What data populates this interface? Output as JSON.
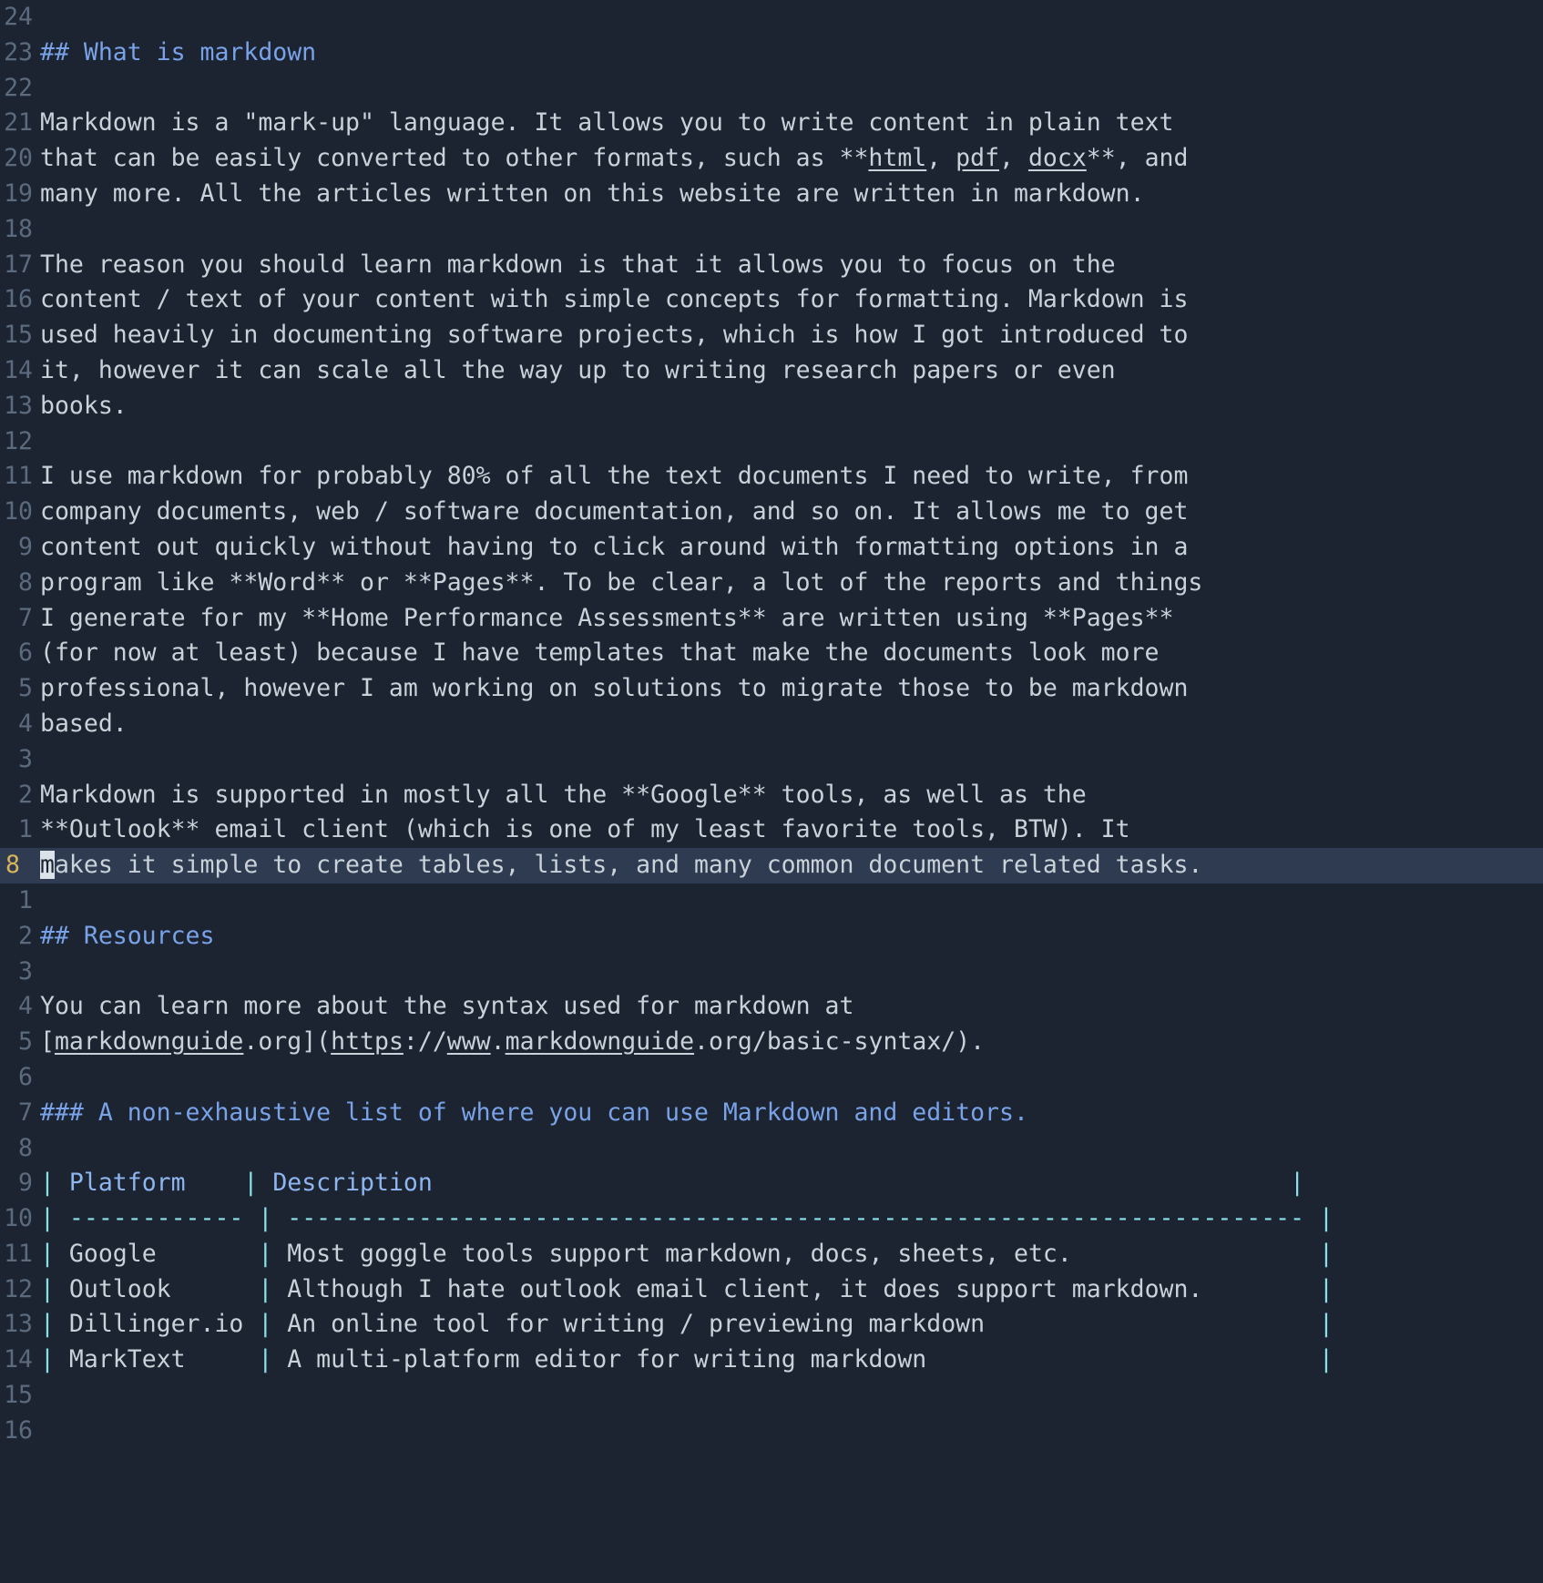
{
  "editor": {
    "name": "vim-markdown-buffer",
    "mode": "normal",
    "colors": {
      "background": "#1b2430",
      "foreground": "#c9d1d9",
      "gutter": "#5c6a7e",
      "cursorline_bg": "#2e3b50",
      "cursorline_number": "#d8b45a",
      "heading": "#7aa2e8",
      "table_pipe": "#8ae0e8",
      "table_header": "#8fb6f0",
      "cursor_block": "#dbe2ea"
    },
    "cursor": {
      "char": "m",
      "line_number": "8",
      "column": 1
    }
  },
  "lines": [
    {
      "num": "24",
      "cursorline": false,
      "kind": "blank",
      "text": ""
    },
    {
      "num": "23",
      "cursorline": false,
      "kind": "heading",
      "text": "## What is markdown"
    },
    {
      "num": "22",
      "cursorline": false,
      "kind": "blank",
      "text": ""
    },
    {
      "num": "21",
      "cursorline": false,
      "kind": "text",
      "text": "Markdown is a \"mark-up\" language. It allows you to write content in plain text"
    },
    {
      "num": "20",
      "cursorline": false,
      "kind": "underlined",
      "text": "that can be easily converted to other formats, such as **html, pdf, docx**, and",
      "segments": [
        {
          "t": "that can be easily converted to other formats, such as **",
          "u": false
        },
        {
          "t": "html",
          "u": true
        },
        {
          "t": ", ",
          "u": false
        },
        {
          "t": "pdf",
          "u": true
        },
        {
          "t": ", ",
          "u": false
        },
        {
          "t": "docx",
          "u": true
        },
        {
          "t": "**, and",
          "u": false
        }
      ]
    },
    {
      "num": "19",
      "cursorline": false,
      "kind": "text",
      "text": "many more. All the articles written on this website are written in markdown."
    },
    {
      "num": "18",
      "cursorline": false,
      "kind": "blank",
      "text": ""
    },
    {
      "num": "17",
      "cursorline": false,
      "kind": "text",
      "text": "The reason you should learn markdown is that it allows you to focus on the"
    },
    {
      "num": "16",
      "cursorline": false,
      "kind": "text",
      "text": "content / text of your content with simple concepts for formatting. Markdown is"
    },
    {
      "num": "15",
      "cursorline": false,
      "kind": "text",
      "text": "used heavily in documenting software projects, which is how I got introduced to"
    },
    {
      "num": "14",
      "cursorline": false,
      "kind": "text",
      "text": "it, however it can scale all the way up to writing research papers or even"
    },
    {
      "num": "13",
      "cursorline": false,
      "kind": "text",
      "text": "books."
    },
    {
      "num": "12",
      "cursorline": false,
      "kind": "blank",
      "text": ""
    },
    {
      "num": "11",
      "cursorline": false,
      "kind": "text",
      "text": "I use markdown for probably 80% of all the text documents I need to write, from"
    },
    {
      "num": "10",
      "cursorline": false,
      "kind": "text",
      "text": "company documents, web / software documentation, and so on. It allows me to get"
    },
    {
      "num": "9",
      "cursorline": false,
      "kind": "text",
      "text": "content out quickly without having to click around with formatting options in a"
    },
    {
      "num": "8",
      "cursorline": false,
      "kind": "text",
      "text": "program like **Word** or **Pages**. To be clear, a lot of the reports and things"
    },
    {
      "num": "7",
      "cursorline": false,
      "kind": "text",
      "text": "I generate for my **Home Performance Assessments** are written using **Pages**"
    },
    {
      "num": "6",
      "cursorline": false,
      "kind": "text",
      "text": "(for now at least) because I have templates that make the documents look more"
    },
    {
      "num": "5",
      "cursorline": false,
      "kind": "text",
      "text": "professional, however I am working on solutions to migrate those to be markdown"
    },
    {
      "num": "4",
      "cursorline": false,
      "kind": "text",
      "text": "based."
    },
    {
      "num": "3",
      "cursorline": false,
      "kind": "blank",
      "text": ""
    },
    {
      "num": "2",
      "cursorline": false,
      "kind": "text",
      "text": "Markdown is supported in mostly all the **Google** tools, as well as the"
    },
    {
      "num": "1",
      "cursorline": false,
      "kind": "text",
      "text": "**Outlook** email client (which is one of my least favorite tools, BTW). It"
    },
    {
      "num": "8",
      "cursorline": true,
      "kind": "cursor",
      "text": "makes it simple to create tables, lists, and many common document related tasks.",
      "cursor_char": "m",
      "rest": "akes it simple to create tables, lists, and many common document related tasks."
    },
    {
      "num": "1",
      "cursorline": false,
      "kind": "blank",
      "text": ""
    },
    {
      "num": "2",
      "cursorline": false,
      "kind": "heading",
      "text": "## Resources"
    },
    {
      "num": "3",
      "cursorline": false,
      "kind": "blank",
      "text": ""
    },
    {
      "num": "4",
      "cursorline": false,
      "kind": "text",
      "text": "You can learn more about the syntax used for markdown at"
    },
    {
      "num": "5",
      "cursorline": false,
      "kind": "underlined",
      "text": "[markdownguide.org](https://www.markdownguide.org/basic-syntax/).",
      "segments": [
        {
          "t": "[",
          "u": false
        },
        {
          "t": "markdownguide",
          "u": true
        },
        {
          "t": ".org](",
          "u": false
        },
        {
          "t": "https",
          "u": true
        },
        {
          "t": "://",
          "u": false
        },
        {
          "t": "www",
          "u": true
        },
        {
          "t": ".",
          "u": false
        },
        {
          "t": "markdownguide",
          "u": true
        },
        {
          "t": ".org/basic-syntax/).",
          "u": false
        }
      ]
    },
    {
      "num": "6",
      "cursorline": false,
      "kind": "blank",
      "text": ""
    },
    {
      "num": "7",
      "cursorline": false,
      "kind": "heading",
      "text": "### A non-exhaustive list of where you can use Markdown and editors."
    },
    {
      "num": "8",
      "cursorline": false,
      "kind": "blank",
      "text": ""
    },
    {
      "num": "9",
      "cursorline": false,
      "kind": "table-header",
      "cells": [
        "Platform   ",
        "Description                                                          "
      ],
      "text": "| Platform    | Description                                                          |"
    },
    {
      "num": "10",
      "cursorline": false,
      "kind": "table-sep",
      "cells": [
        "------------",
        "----------------------------------------------------------------------"
      ],
      "text": "| ------------ | --------------------------------------------------------------------- |"
    },
    {
      "num": "11",
      "cursorline": false,
      "kind": "table-row",
      "cells": [
        "Google      ",
        "Most goggle tools support markdown, docs, sheets, etc.                "
      ],
      "text": "| Google       | Most goggle tools support markdown, docs, sheets, etc.                 |"
    },
    {
      "num": "12",
      "cursorline": false,
      "kind": "table-row",
      "cells": [
        "Outlook     ",
        "Although I hate outlook email client, it does support markdown.       "
      ],
      "text": "| Outlook      | Although I hate outlook email client, it does support markdown.        |"
    },
    {
      "num": "13",
      "cursorline": false,
      "kind": "table-row",
      "cells": [
        "Dillinger.io",
        "An online tool for writing / previewing markdown                      "
      ],
      "text": "| Dillinger.io | An online tool for writing / previewing markdown                       |"
    },
    {
      "num": "14",
      "cursorline": false,
      "kind": "table-row",
      "cells": [
        "MarkText    ",
        "A multi-platform editor for writing markdown                          "
      ],
      "text": "| MarkText     | A multi-platform editor for writing markdown                           |"
    },
    {
      "num": "15",
      "cursorline": false,
      "kind": "blank",
      "text": ""
    },
    {
      "num": "16",
      "cursorline": false,
      "kind": "blank",
      "text": ""
    }
  ]
}
